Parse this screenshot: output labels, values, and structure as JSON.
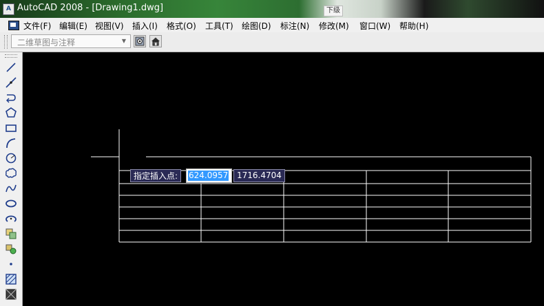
{
  "window": {
    "title": "AutoCAD 2008 - [Drawing1.dwg]",
    "app_icon": "A",
    "background_chip": "下级"
  },
  "menu": {
    "items": [
      "文件(F)",
      "编辑(E)",
      "视图(V)",
      "插入(I)",
      "格式(O)",
      "工具(T)",
      "绘图(D)",
      "标注(N)",
      "修改(M)",
      "窗口(W)",
      "帮助(H)"
    ]
  },
  "toolbar": {
    "workspace_value": "二维草图与注释",
    "icons": [
      "workspace-settings-icon",
      "home-icon"
    ]
  },
  "draw_toolbar": {
    "tools": [
      "line-icon",
      "construction-line-icon",
      "polyline-icon",
      "polygon-icon",
      "rectangle-icon",
      "arc-icon",
      "circle-icon",
      "revision-cloud-icon",
      "spline-icon",
      "ellipse-icon",
      "ellipse-arc-icon",
      "insert-block-icon",
      "make-block-icon",
      "point-icon",
      "hatch-icon",
      "gradient-icon"
    ]
  },
  "canvas": {
    "background": "#000000",
    "dynamic_input": {
      "prompt": "指定插入点:",
      "x_value": "624.0957",
      "y_value": "1716.4704"
    },
    "table": {
      "columns": 5,
      "data_rows": 5
    }
  },
  "colors": {
    "selection": "#3399ff",
    "tooltip_bg": "#2a2a55"
  }
}
